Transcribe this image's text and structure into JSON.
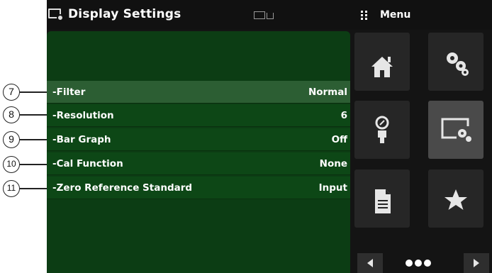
{
  "header": {
    "title": "Display Settings",
    "menu_label": "Menu"
  },
  "settings": [
    {
      "label": "-Filter",
      "value": "Normal",
      "selected": true
    },
    {
      "label": "-Resolution",
      "value": "6",
      "selected": false
    },
    {
      "label": "-Bar Graph",
      "value": "Off",
      "selected": false
    },
    {
      "label": "-Cal Function",
      "value": "None",
      "selected": false
    },
    {
      "label": "-Zero Reference Standard",
      "value": "Input",
      "selected": false
    }
  ],
  "callouts": [
    "7",
    "8",
    "9",
    "10",
    "11"
  ],
  "menu": {
    "tiles": [
      {
        "icon": "home-icon"
      },
      {
        "icon": "gears-icon"
      },
      {
        "icon": "gauge-icon"
      },
      {
        "icon": "display-settings-icon",
        "active": true
      },
      {
        "icon": "document-icon"
      },
      {
        "icon": "star-icon"
      }
    ],
    "nav": {
      "prev": "prev-arrow-icon",
      "next": "next-arrow-icon",
      "pager": "ellipsis-icon"
    }
  },
  "colors": {
    "panel": "#0c3d14",
    "row": "#0d4716",
    "row_selected": "#2c5e33",
    "screen_bg": "#141414",
    "tile": "#262626",
    "tile_active": "#4a4a4a"
  }
}
